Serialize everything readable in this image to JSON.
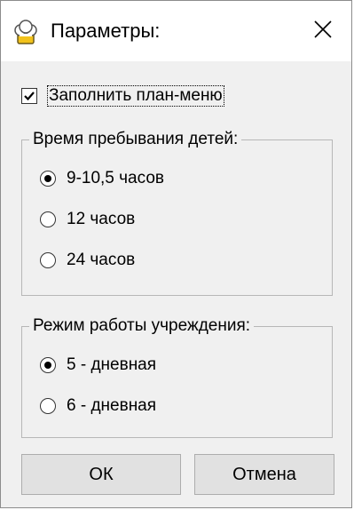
{
  "window": {
    "title": "Параметры:",
    "icon": "chef-hat-icon",
    "close_icon": "close-icon"
  },
  "fill_plan_menu": {
    "label": "Заполнить план-меню",
    "checked": true
  },
  "stay_time": {
    "legend": "Время пребывания детей:",
    "options": [
      {
        "label": "9-10,5 часов",
        "selected": true
      },
      {
        "label": "12 часов",
        "selected": false
      },
      {
        "label": "24 часов",
        "selected": false
      }
    ]
  },
  "work_mode": {
    "legend": "Режим работы учреждения:",
    "options": [
      {
        "label": "5 - дневная",
        "selected": true
      },
      {
        "label": "6 - дневная",
        "selected": false
      }
    ]
  },
  "buttons": {
    "ok": "ОК",
    "cancel": "Отмена"
  }
}
